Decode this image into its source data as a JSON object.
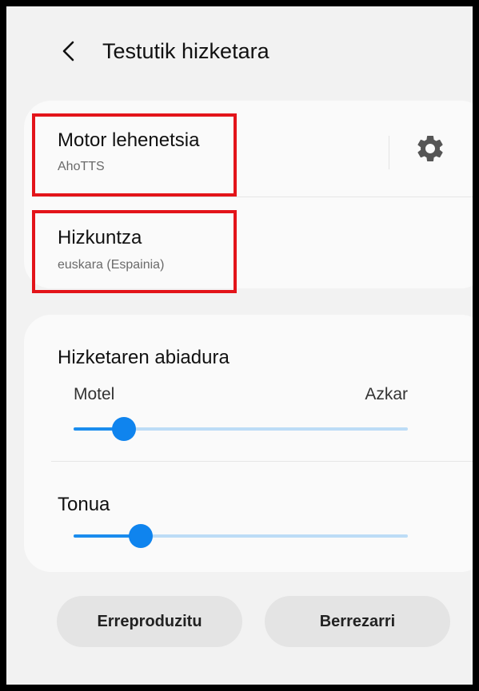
{
  "header": {
    "back_icon": "chevron-left-icon",
    "title": "Testutik hizketara"
  },
  "engine": {
    "title": "Motor lehenetsia",
    "value": "AhoTTS",
    "settings_icon": "gear-icon",
    "highlighted": true
  },
  "language": {
    "title": "Hizkuntza",
    "value": "euskara (Espainia)",
    "highlighted": true
  },
  "speech_rate": {
    "title": "Hizketaren abiadura",
    "min_label": "Motel",
    "max_label": "Azkar",
    "level": 0.15
  },
  "pitch": {
    "title": "Tonua",
    "level": 0.2
  },
  "buttons": {
    "play": "Erreproduzitu",
    "reset": "Berrezarri"
  },
  "colors": {
    "accent": "#0f84ee",
    "track": "#bcdcf6",
    "highlight": "#e3141a",
    "background": "#f2f2f2",
    "card": "#fafafa"
  }
}
